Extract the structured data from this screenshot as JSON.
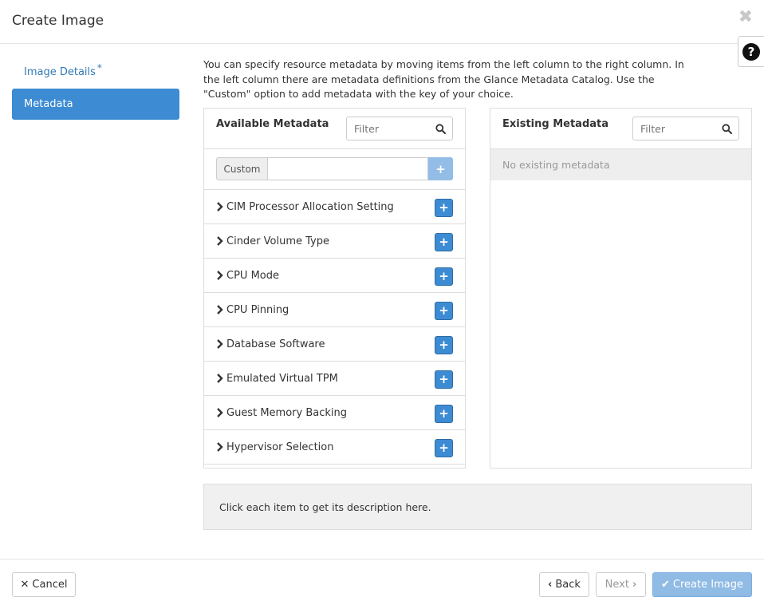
{
  "dialog": {
    "title": "Create Image",
    "close_icon": "close-icon",
    "help_icon": "question-circle-icon",
    "help_glyph": "?"
  },
  "nav": {
    "items": [
      {
        "label": "Image Details",
        "required_marker": "*"
      },
      {
        "label": "Metadata"
      }
    ]
  },
  "intro_text": "You can specify resource metadata by moving items from the left column to the right column. In the left column there are metadata definitions from the Glance Metadata Catalog. Use the \"Custom\" option to add metadata with the key of your choice.",
  "available": {
    "title": "Available Metadata",
    "filter_placeholder": "Filter",
    "custom_label": "Custom",
    "custom_value": "",
    "items": [
      "CIM Processor Allocation Setting",
      "Cinder Volume Type",
      "CPU Mode",
      "CPU Pinning",
      "Database Software",
      "Emulated Virtual TPM",
      "Guest Memory Backing",
      "Hypervisor Selection"
    ]
  },
  "existing": {
    "title": "Existing Metadata",
    "filter_placeholder": "Filter",
    "empty_text": "No existing metadata"
  },
  "description_text": "Click each item to get its description here.",
  "footer": {
    "cancel_label": "Cancel",
    "back_label": "Back",
    "next_label": "Next",
    "create_label": "Create Image"
  },
  "colors": {
    "accent": "#3d8bd3",
    "disabled_primary": "#8fbbe4"
  }
}
